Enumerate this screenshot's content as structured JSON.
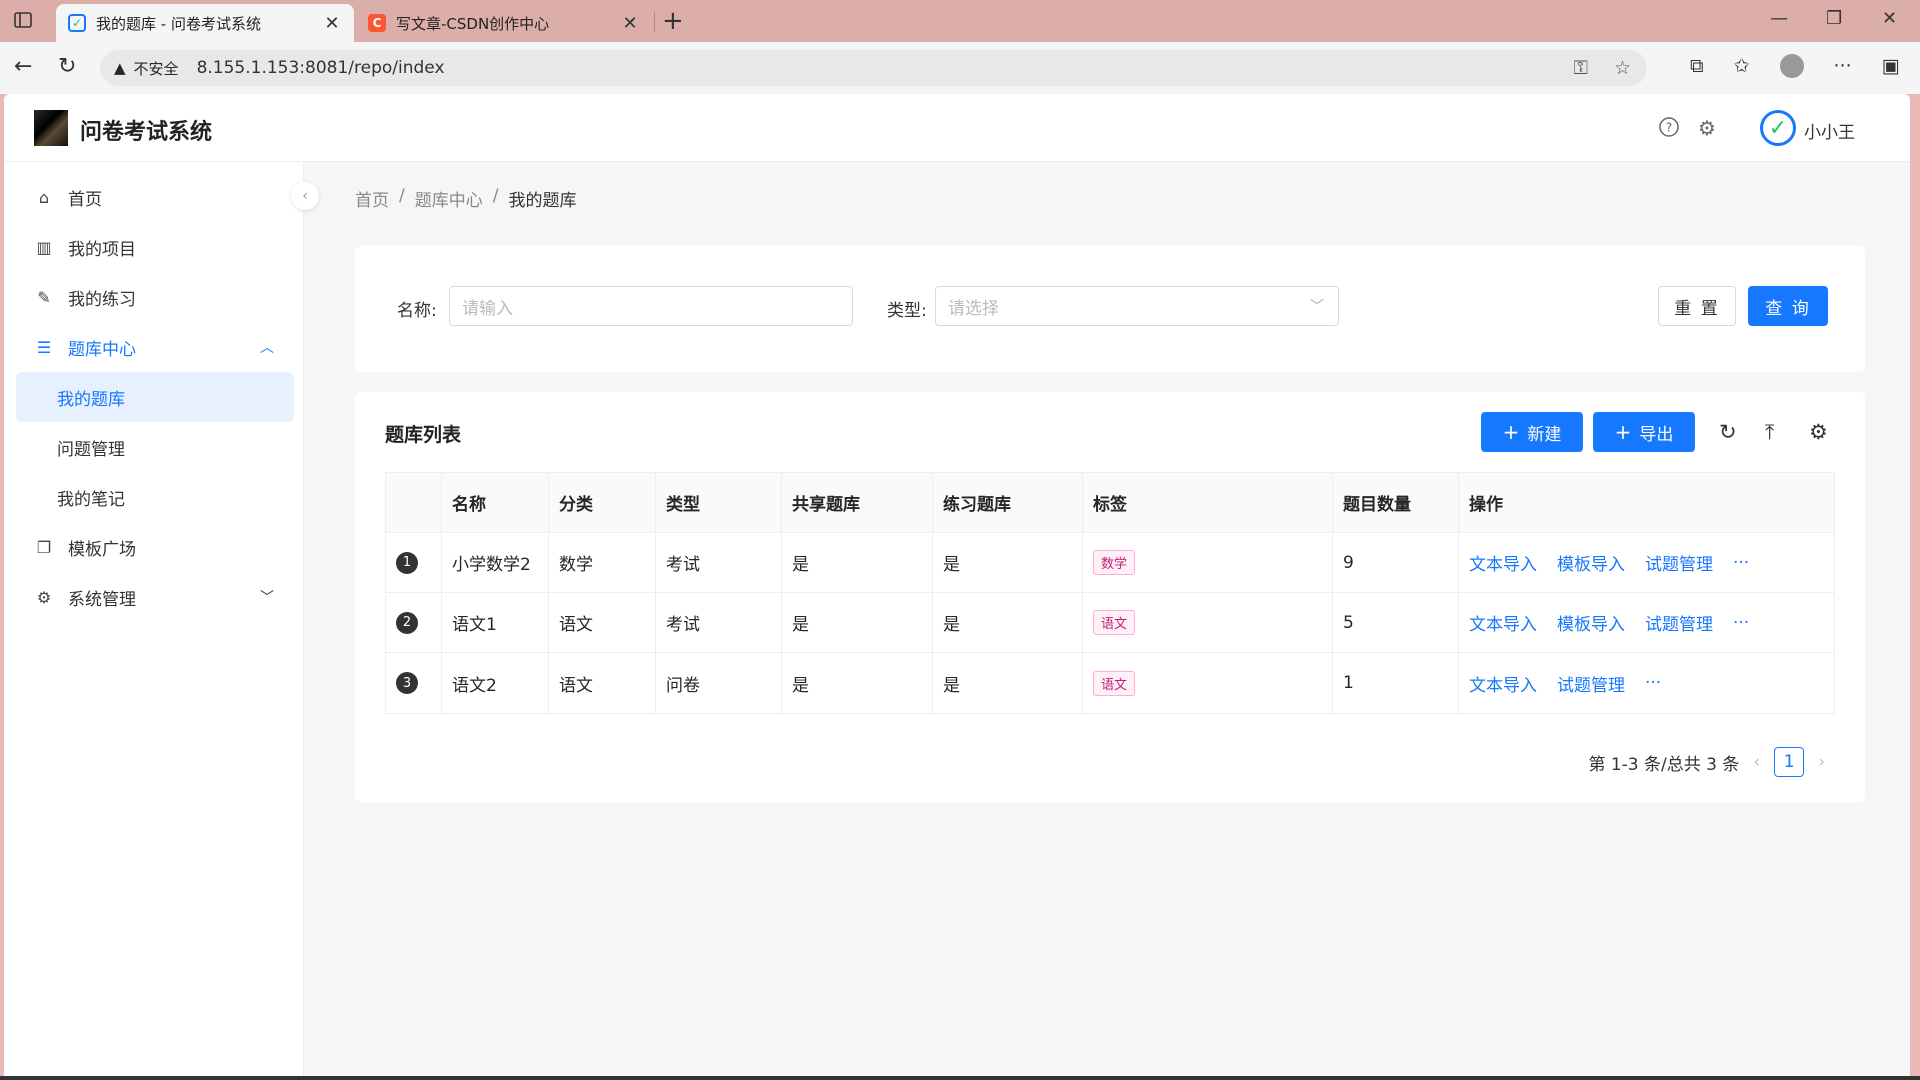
{
  "browser": {
    "tabs": [
      {
        "title": "我的题库 - 问卷考试系统",
        "active": true
      },
      {
        "title": "写文章-CSDN创作中心",
        "active": false
      }
    ],
    "security_label": "不安全",
    "url": "8.155.1.153:8081/repo/index"
  },
  "app": {
    "title": "问卷考试系统",
    "user": "小小王",
    "user_initial": "✓"
  },
  "sidebar": {
    "items": [
      {
        "label": "首页",
        "icon": "home-icon"
      },
      {
        "label": "我的项目",
        "icon": "project-icon"
      },
      {
        "label": "我的练习",
        "icon": "edit-icon"
      },
      {
        "label": "题库中心",
        "icon": "list-icon"
      },
      {
        "label": "模板广场",
        "icon": "copy-icon"
      },
      {
        "label": "系统管理",
        "icon": "gear-icon"
      }
    ],
    "sub_items": [
      {
        "label": "我的题库"
      },
      {
        "label": "问题管理"
      },
      {
        "label": "我的笔记"
      }
    ]
  },
  "breadcrumb": [
    "首页",
    "题库中心",
    "我的题库"
  ],
  "search": {
    "name_label": "名称:",
    "name_placeholder": "请输入",
    "type_label": "类型:",
    "type_placeholder": "请选择",
    "reset_label": "重 置",
    "query_label": "查 询"
  },
  "table": {
    "title": "题库列表",
    "new_label": "新建",
    "export_label": "导出",
    "columns": [
      "",
      "名称",
      "分类",
      "类型",
      "共享题库",
      "练习题库",
      "标签",
      "题目数量",
      "操作"
    ],
    "rows": [
      {
        "idx": "1",
        "name": "小学数学2",
        "category": "数学",
        "type": "考试",
        "shared": "是",
        "practice": "是",
        "tag": "数学",
        "count": "9",
        "ops": [
          "文本导入",
          "模板导入",
          "试题管理"
        ],
        "more": "···"
      },
      {
        "idx": "2",
        "name": "语文1",
        "category": "语文",
        "type": "考试",
        "shared": "是",
        "practice": "是",
        "tag": "语文",
        "count": "5",
        "ops": [
          "文本导入",
          "模板导入",
          "试题管理"
        ],
        "more": "···"
      },
      {
        "idx": "3",
        "name": "语文2",
        "category": "语文",
        "type": "问卷",
        "shared": "是",
        "practice": "是",
        "tag": "语文",
        "count": "1",
        "ops": [
          "文本导入",
          "",
          "试题管理"
        ],
        "more": "···"
      }
    ],
    "pagination_text": "第 1-3 条/总共 3 条",
    "current_page": "1"
  },
  "colors": {
    "primary": "#1677ff",
    "tag_pink": "#c41d7f"
  }
}
